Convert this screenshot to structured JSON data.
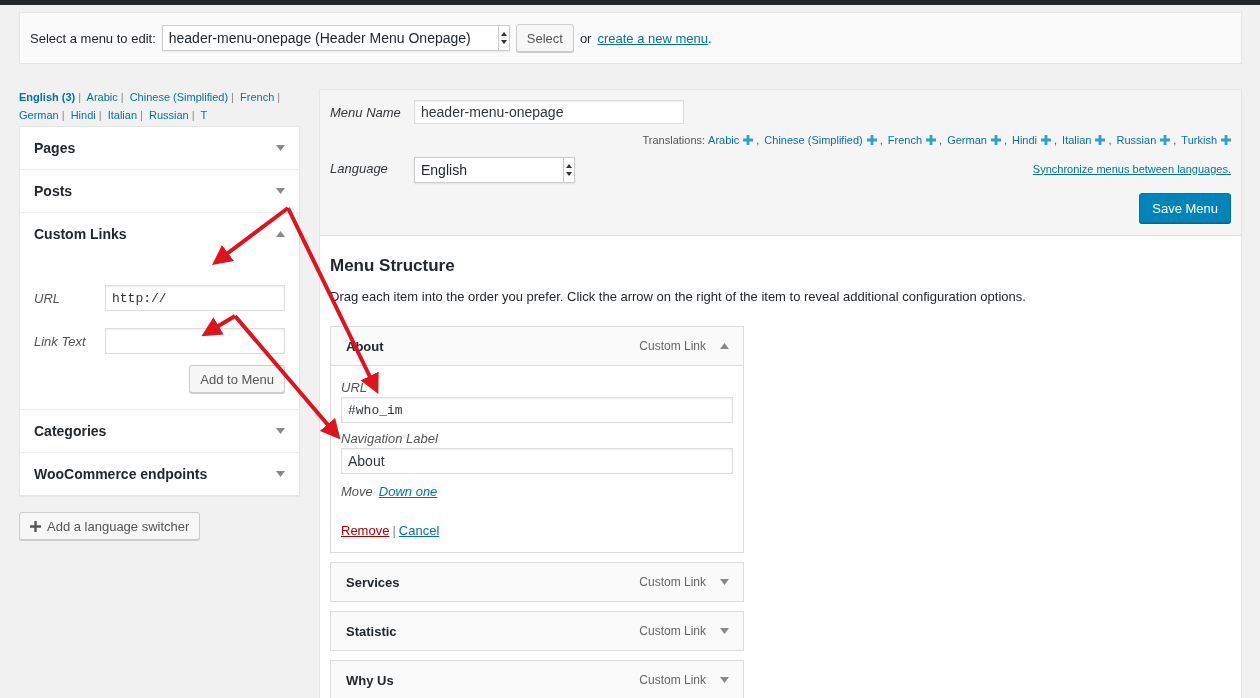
{
  "menu_select": {
    "label": "Select a menu to edit:",
    "value": "header-menu-onepage (Header Menu Onepage)",
    "button": "Select",
    "or_text": "or",
    "create_link": "create a new menu",
    "end": "."
  },
  "language_links": [
    {
      "label": "English (3)",
      "selected": true
    },
    {
      "label": "Arabic",
      "selected": false
    },
    {
      "label": "Chinese (Simplified)",
      "selected": false
    },
    {
      "label": "French",
      "selected": false
    },
    {
      "label": "German",
      "selected": false
    },
    {
      "label": "Hindi",
      "selected": false
    },
    {
      "label": "Italian",
      "selected": false
    },
    {
      "label": "Russian",
      "selected": false
    },
    {
      "label": "T",
      "selected": false
    }
  ],
  "accordion": [
    {
      "title": "Pages",
      "expanded": false
    },
    {
      "title": "Posts",
      "expanded": false
    },
    {
      "title": "Custom Links",
      "expanded": true,
      "form": {
        "url_label": "URL",
        "url_value": "http://",
        "link_text_label": "Link Text",
        "button": "Add to Menu"
      }
    },
    {
      "title": "Categories",
      "expanded": false
    },
    {
      "title": "WooCommerce endpoints",
      "expanded": false
    }
  ],
  "language_separator": "|",
  "language_switcher_button": "Add a language switcher",
  "menu_settings": {
    "name_label": "Menu Name",
    "name_value": "header-menu-onepage",
    "translations_label": "Translations:",
    "translation_separator": ",",
    "translations": [
      "Arabic",
      "Chinese (Simplified)",
      "French",
      "German",
      "Hindi",
      "Italian",
      "Russian",
      "Turkish"
    ],
    "language_label": "Language",
    "language_value": "English",
    "sync_link": "Synchronize menus between languages.",
    "save_button": "Save Menu"
  },
  "menu_structure": {
    "title": "Menu Structure",
    "hint": "Drag each item into the order you prefer. Click the arrow on the right of the item to reveal additional configuration options.",
    "items": [
      {
        "title": "About",
        "type": "Custom Link",
        "expanded": true,
        "settings": {
          "url_label": "URL",
          "url": "#who_im",
          "nav_label_label": "Navigation Label",
          "nav_label": "About",
          "move_label": "Move",
          "move_link": "Down one",
          "remove": "Remove",
          "separator": "|",
          "cancel": "Cancel"
        }
      },
      {
        "title": "Services",
        "type": "Custom Link",
        "expanded": false
      },
      {
        "title": "Statistic",
        "type": "Custom Link",
        "expanded": false
      },
      {
        "title": "Why Us",
        "type": "Custom Link",
        "expanded": false
      }
    ]
  }
}
